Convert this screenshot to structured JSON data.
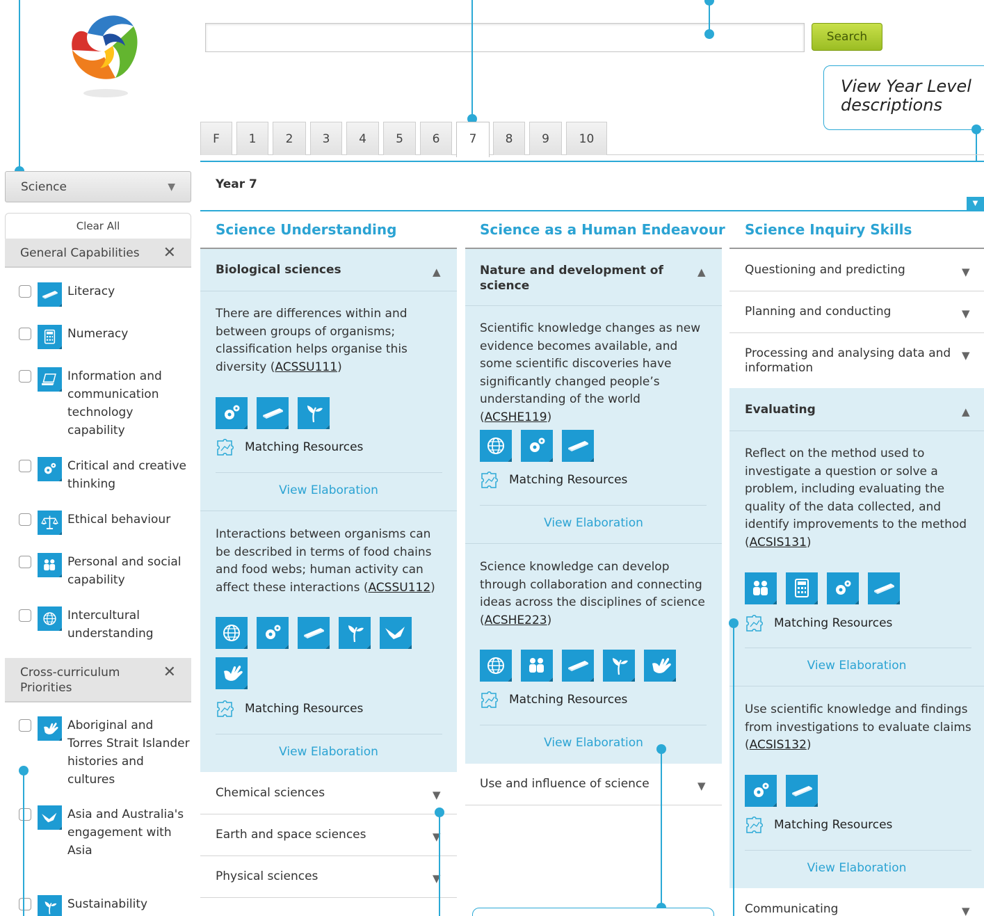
{
  "search": {
    "button_label": "Search",
    "value": ""
  },
  "tooltip": {
    "line1": "View Year Level",
    "line2": "descriptions"
  },
  "year_tabs": [
    "F",
    "1",
    "2",
    "3",
    "4",
    "5",
    "6",
    "7",
    "8",
    "9",
    "10"
  ],
  "active_tab": "7",
  "year_title": "Year 7",
  "sidebar": {
    "subject": "Science",
    "clear_all": "Clear All",
    "general_capabilities": {
      "title": "General Capabilities",
      "items": [
        {
          "label": "Literacy",
          "icon": "literacy-icon"
        },
        {
          "label": "Numeracy",
          "icon": "numeracy-icon"
        },
        {
          "label": "Information and communication technology capability",
          "icon": "ict-icon"
        },
        {
          "label": "Critical and creative thinking",
          "icon": "critical-thinking-icon"
        },
        {
          "label": "Ethical behaviour",
          "icon": "ethical-behaviour-icon"
        },
        {
          "label": "Personal and social capability",
          "icon": "personal-social-icon"
        },
        {
          "label": "Intercultural understanding",
          "icon": "intercultural-icon"
        }
      ]
    },
    "cross_curriculum": {
      "title": "Cross-curriculum Priorities",
      "items": [
        {
          "label": "Aboriginal and Torres Strait Islander histories and cultures",
          "icon": "aboriginal-icon"
        },
        {
          "label": "Asia and Australia's engagement with Asia",
          "icon": "asia-icon"
        },
        {
          "label": "Sustainability",
          "icon": "sustainability-icon"
        }
      ]
    }
  },
  "columns": {
    "understanding": {
      "title": "Science Understanding",
      "open_section": "Biological sciences",
      "entries": [
        {
          "text": "There are differences within and between groups of organisms; classification helps organise this diversity (",
          "code": "ACSSU111",
          "tail": ")"
        },
        {
          "text": "Interactions between organisms can be described in terms of food chains and food webs; human activity can affect these interactions (",
          "code": "ACSSU112",
          "tail": ")"
        }
      ],
      "closed_sections": [
        "Chemical sciences",
        "Earth and space sciences",
        "Physical sciences"
      ]
    },
    "endeavour": {
      "title": "Science as a Human Endeavour",
      "open_section": "Nature and development of science",
      "entries": [
        {
          "text": "Scientific knowledge changes as new evidence becomes available, and some scientific discoveries have significantly changed people’s understanding of the world (",
          "code": "ACSHE119",
          "tail": ")"
        },
        {
          "text": "Science knowledge can develop through collaboration and connecting ideas across the disciplines of science (",
          "code": "ACSHE223",
          "tail": ")"
        }
      ],
      "closed_sections": [
        "Use and influence of science"
      ]
    },
    "inquiry": {
      "title": "Science Inquiry Skills",
      "closed_sections_top": [
        "Questioning and predicting",
        "Planning and conducting",
        "Processing and analysing data and information"
      ],
      "open_section": "Evaluating",
      "entries": [
        {
          "text": "Reflect on the method used to investigate a question or solve a problem, including evaluating the quality of the data collected, and identify improvements to the method (",
          "code": "ACSIS131",
          "tail": ")"
        },
        {
          "text": "Use scientific knowledge and findings from investigations to evaluate claims (",
          "code": "ACSIS132",
          "tail": ")"
        }
      ],
      "closed_sections_bottom": [
        "Communicating"
      ]
    }
  },
  "labels": {
    "matching_resources": "Matching Resources",
    "view_elaboration": "View Elaboration"
  },
  "colors": {
    "accent": "#2ba9d6",
    "panel": "#dceef5",
    "search_button": "#b5d135"
  }
}
